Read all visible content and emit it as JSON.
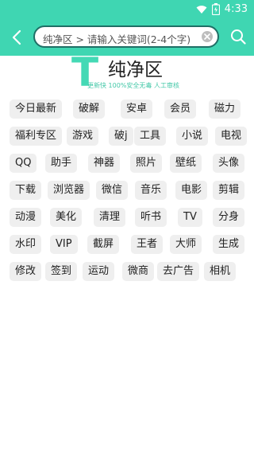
{
  "status_bar": {
    "time": "4:33",
    "icons": [
      "wifi-icon",
      "battery-icon"
    ]
  },
  "toolbar": {
    "back_icon": "back-arrow-icon",
    "search_text": "纯净区 > 请输入关键词(2-4个字)",
    "clear_icon": "clear-icon",
    "search_icon": "search-icon"
  },
  "logo": {
    "letter": "T",
    "title": "纯净区",
    "subtitle": "更新快  100%安全无毒  人工审核"
  },
  "tags": [
    [
      "今日最新",
      "破解",
      "安卓",
      "会员",
      "磁力"
    ],
    [
      "福利专区",
      "游戏",
      "破j",
      "工具",
      "小说",
      "电视"
    ],
    [
      "QQ",
      "助手",
      "神器",
      "照片",
      "壁纸",
      "头像"
    ],
    [
      "下载",
      "浏览器",
      "微信",
      "音乐",
      "电影",
      "剪辑"
    ],
    [
      "动漫",
      "美化",
      "清理",
      "听书",
      "TV",
      "分身"
    ],
    [
      "水印",
      "VIP",
      "截屏",
      "王者",
      "大师",
      "生成"
    ],
    [
      "修改",
      "签到",
      "运动",
      "微商",
      "去广告",
      "相机"
    ]
  ],
  "colors": {
    "accent": "#3fd6b2",
    "tag_bg": "#efefef"
  }
}
